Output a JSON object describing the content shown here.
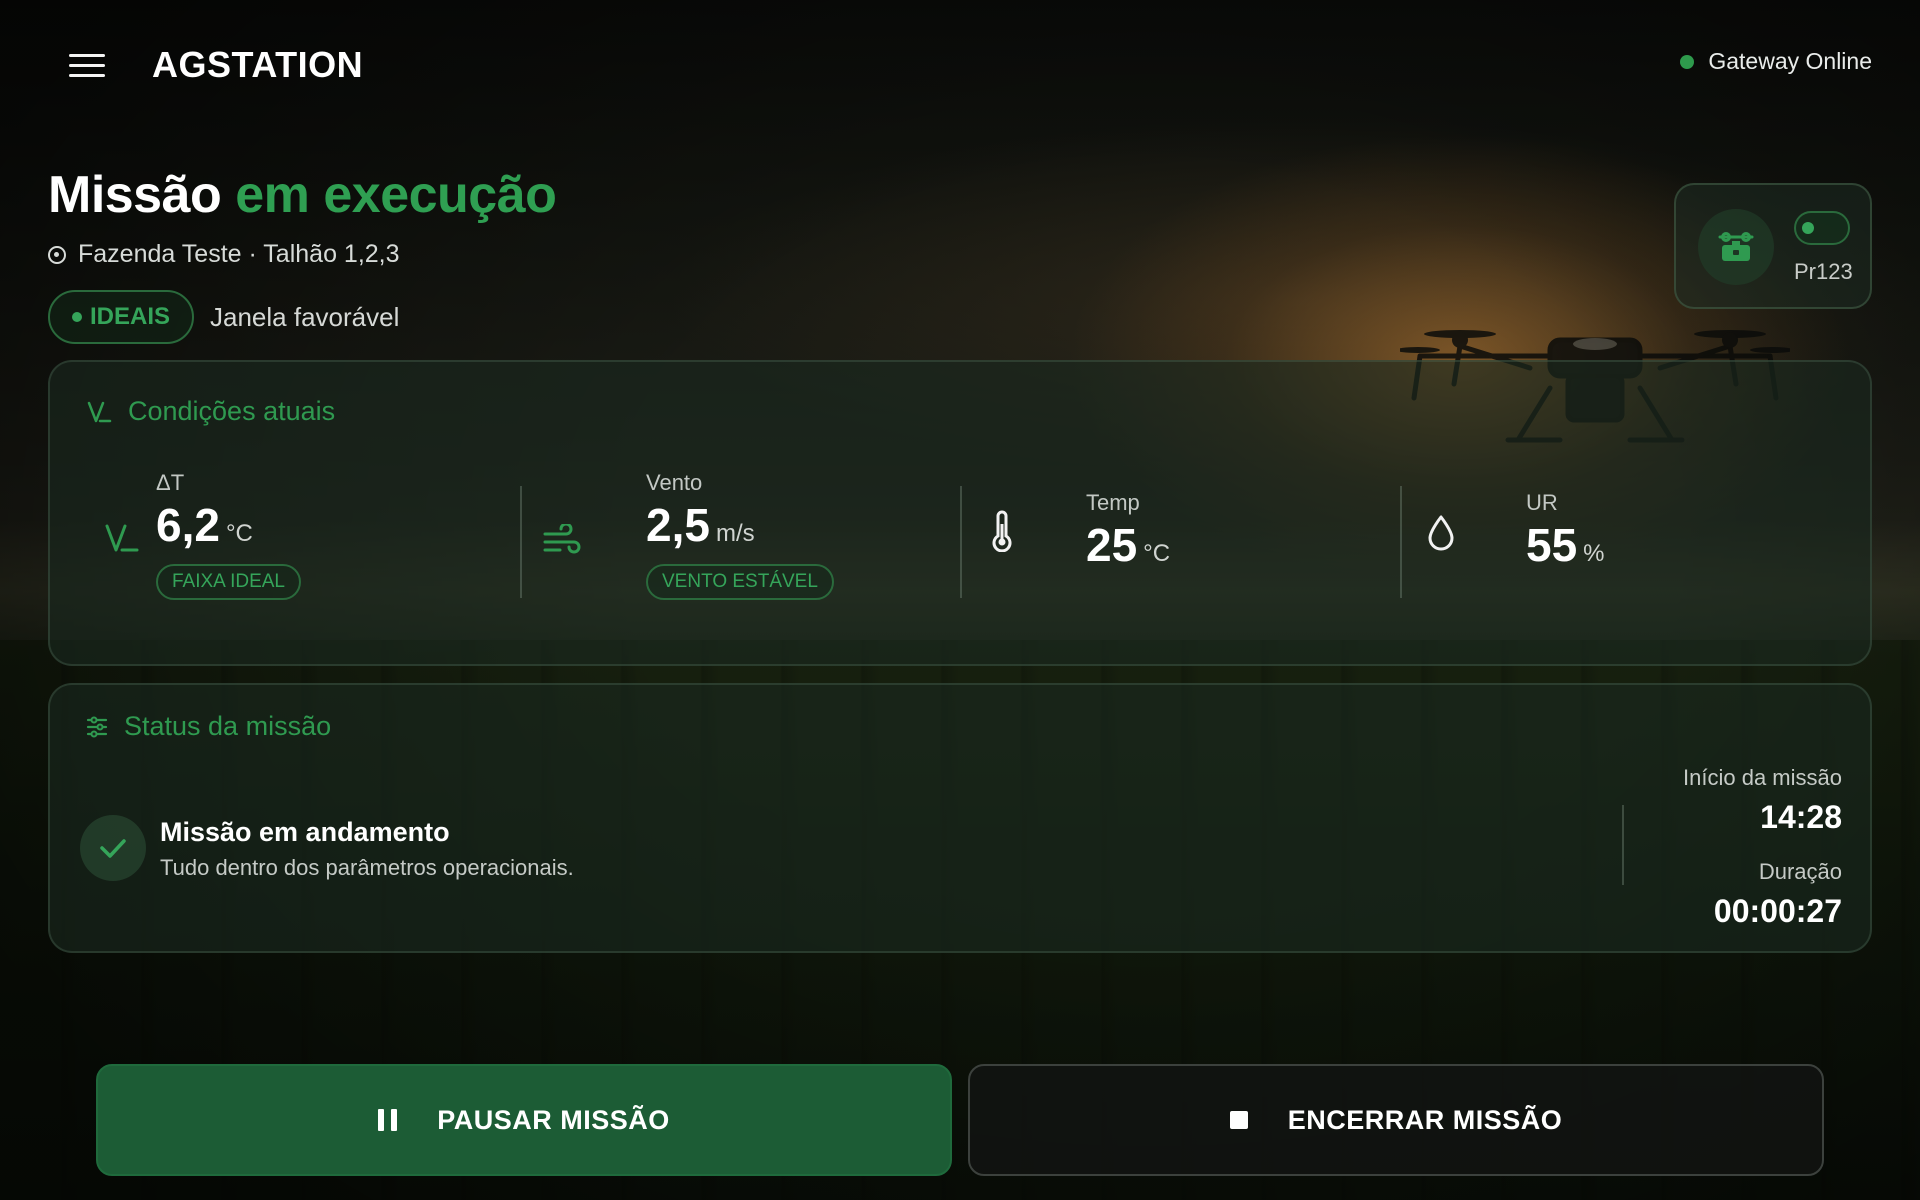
{
  "header": {
    "brand": "AGSTATION",
    "gateway_status": "Gateway Online"
  },
  "mission": {
    "title_main": "Missão",
    "title_accent": "em execução",
    "location": "Fazenda Teste · Talhão 1,2,3",
    "badge": "IDEAIS",
    "window_text": "Janela favorável"
  },
  "device": {
    "label": "Pr123",
    "icon": "sprayer-device-icon",
    "toggle_on": true
  },
  "conditions": {
    "title": "Condições atuais",
    "delta_t": {
      "label": "ΔT",
      "value": "6,2",
      "unit": "°C",
      "tag": "FAIXA IDEAL"
    },
    "wind": {
      "label": "Vento",
      "value": "2,5",
      "unit": "m/s",
      "tag": "VENTO ESTÁVEL"
    },
    "temp": {
      "label": "Temp",
      "value": "25",
      "unit": "°C"
    },
    "humidity": {
      "label": "UR",
      "value": "55",
      "unit": "%"
    }
  },
  "status": {
    "title": "Status da missão",
    "main": "Missão em andamento",
    "sub": "Tudo dentro dos parâmetros operacionais.",
    "start_label": "Início da missão",
    "start_value": "14:28",
    "duration_label": "Duração",
    "duration_value": "00:00:27"
  },
  "actions": {
    "pause": "PAUSAR MISSÃO",
    "end": "ENCERRAR MISSÃO"
  },
  "colors": {
    "accent": "#2f9f52",
    "pause_button": "#1c5c35",
    "status_online": "#2e9a4c"
  }
}
